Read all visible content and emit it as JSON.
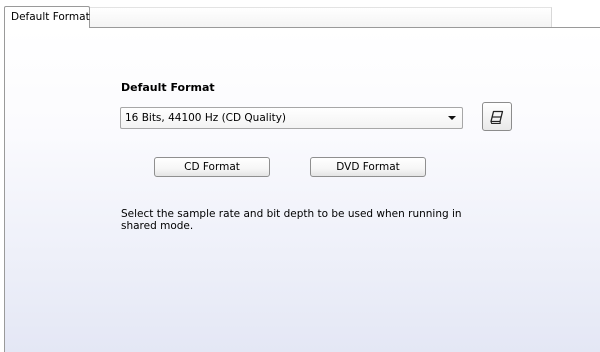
{
  "tabs": [
    {
      "label": "Default Format",
      "selected": true
    }
  ],
  "panel": {
    "heading": "Default Format",
    "format_select": {
      "value": "16 Bits, 44100 Hz (CD Quality)"
    },
    "format_icon": "eraser-icon",
    "buttons": {
      "cd_format": "CD Format",
      "dvd_format": "DVD Format"
    },
    "description": "Select the sample rate and bit depth to be used when running in shared mode."
  }
}
